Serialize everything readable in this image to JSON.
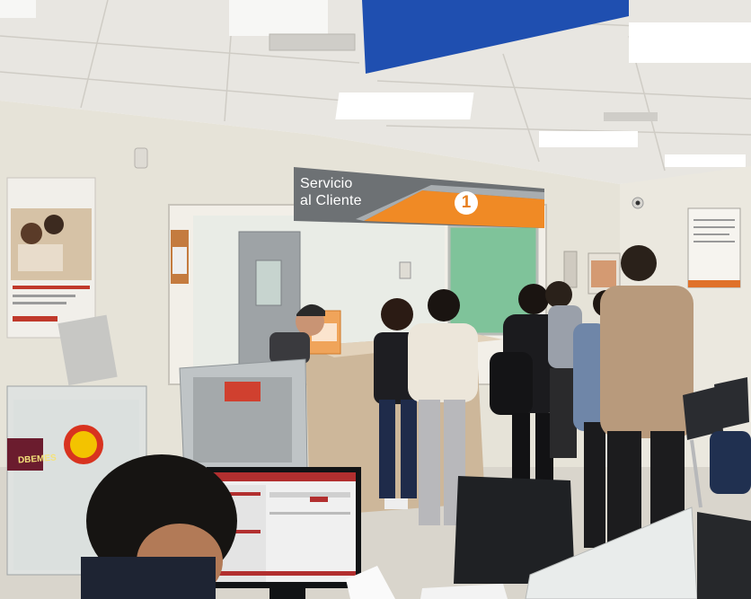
{
  "banner": {
    "line1": "Servicio",
    "line2": "al Cliente",
    "number": "1"
  },
  "sticker": {
    "text": "DBEMES"
  },
  "colors": {
    "ceiling": "#e9e7e2",
    "wall": "#e6e3d8",
    "banner_grey": "#6d7174",
    "banner_orange": "#f08a25",
    "overhead_sign_blue": "#1f4fb0",
    "counter_marble": "#cdb79a",
    "floor": "#d9d5cc",
    "glass_green": "#7fc39a"
  },
  "icons": [
    "ceiling-light-icon",
    "security-camera-icon",
    "monitor-icon"
  ]
}
